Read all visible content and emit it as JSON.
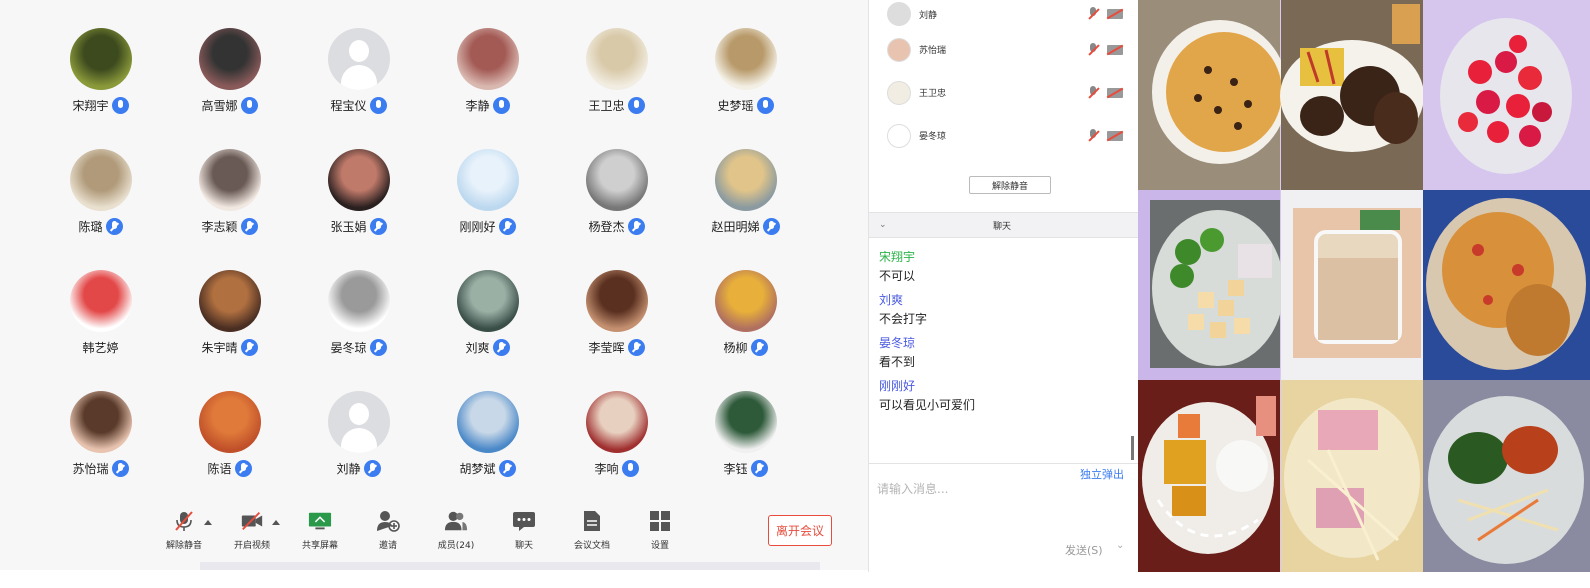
{
  "participants": [
    {
      "name": "宋翔宇",
      "mic": "on",
      "avatar_color": "#8a9a3a",
      "avatar_color2": "#3d4a1e"
    },
    {
      "name": "高雪娜",
      "mic": "on",
      "avatar_color": "#8a5a5a",
      "avatar_color2": "#333333",
      "host": true
    },
    {
      "name": "程宝仪",
      "mic": "on",
      "avatar_color": "blank"
    },
    {
      "name": "李静",
      "mic": "on",
      "avatar_color": "#d9b8b0",
      "avatar_color2": "#a35a55"
    },
    {
      "name": "王卫忠",
      "mic": "on",
      "avatar_color": "#f2ede2",
      "avatar_color2": "#d8c9a8"
    },
    {
      "name": "史梦瑶",
      "mic": "on",
      "avatar_color": "#f3efe4",
      "avatar_color2": "#b89a6a"
    },
    {
      "name": "陈璐",
      "mic": "muted",
      "avatar_color": "#e9e0cf",
      "avatar_color2": "#b09a7a"
    },
    {
      "name": "李志颖",
      "mic": "muted",
      "avatar_color": "#f2e8e2",
      "avatar_color2": "#6a5a55"
    },
    {
      "name": "张玉娟",
      "mic": "muted",
      "avatar_color": "#2a2020",
      "avatar_color2": "#c07a6a"
    },
    {
      "name": "刚刚好",
      "mic": "muted",
      "avatar_color": "#bcd8ef",
      "avatar_color2": "#e8f2fb"
    },
    {
      "name": "杨登杰",
      "mic": "muted",
      "avatar_color": "#777777",
      "avatar_color2": "#cfcfcf"
    },
    {
      "name": "赵田明娣",
      "mic": "muted",
      "avatar_color": "#8a9aa0",
      "avatar_color2": "#e0c48a"
    },
    {
      "name": "韩艺婷",
      "mic": "none",
      "avatar_color": "#ffffff",
      "avatar_color2": "#e34848"
    },
    {
      "name": "朱宇晴",
      "mic": "muted",
      "avatar_color": "#4a2e22",
      "avatar_color2": "#b07040"
    },
    {
      "name": "晏冬琼",
      "mic": "muted",
      "avatar_color": "#ffffff",
      "avatar_color2": "#9a9a9a"
    },
    {
      "name": "刘爽",
      "mic": "muted",
      "avatar_color": "#3a4e48",
      "avatar_color2": "#9ab0a5"
    },
    {
      "name": "李莹晖",
      "mic": "muted",
      "avatar_color": "#c49070",
      "avatar_color2": "#5a3020"
    },
    {
      "name": "杨柳",
      "mic": "muted",
      "avatar_color": "#b07060",
      "avatar_color2": "#e8b03a"
    },
    {
      "name": "苏怡瑞",
      "mic": "muted",
      "avatar_color": "#e8c4b0",
      "avatar_color2": "#5a3a2a"
    },
    {
      "name": "陈语",
      "mic": "muted",
      "avatar_color": "#c0502a",
      "avatar_color2": "#e07a3a"
    },
    {
      "name": "刘静",
      "mic": "muted",
      "avatar_color": "blank"
    },
    {
      "name": "胡梦斌",
      "mic": "muted",
      "avatar_color": "#4a88c8",
      "avatar_color2": "#c8d8e8"
    },
    {
      "name": "李响",
      "mic": "on",
      "avatar_color": "#a03030",
      "avatar_color2": "#e8d0c0"
    },
    {
      "name": "李钰",
      "mic": "muted",
      "avatar_color": "#f0f0f0",
      "avatar_color2": "#2e5a3a"
    }
  ],
  "toolbar": {
    "unmute": "解除静音",
    "video": "开启视频",
    "share": "共享屏幕",
    "invite": "邀请",
    "members": "成员(24)",
    "chat": "聊天",
    "docs": "会议文档",
    "settings": "设置",
    "leave": "离开会议"
  },
  "member_list": [
    {
      "name": "刘静",
      "avatar_color": "#dddddd"
    },
    {
      "name": "苏怡瑞",
      "avatar_color": "#e8c4b0"
    },
    {
      "name": "王卫忠",
      "avatar_color": "#f2ede2"
    },
    {
      "name": "晏冬琼",
      "avatar_color": "#ffffff"
    }
  ],
  "unmute_all": "解除静音",
  "chat": {
    "title": "聊天",
    "collapse_icon": "chevron-down-icon",
    "messages": [
      {
        "sender": "宋翔宇",
        "color": "#2db34a",
        "text": "不可以"
      },
      {
        "sender": "刘爽",
        "color": "#4a5ae0",
        "text": "不会打字"
      },
      {
        "sender": "晏冬琼",
        "color": "#4a5ae0",
        "text": "看不到"
      },
      {
        "sender": "刚刚好",
        "color": "#4a5ae0",
        "text": "可以看见小可爱们"
      }
    ],
    "popout": "独立弹出",
    "input_placeholder": "请输入消息...",
    "send": "发送(S)"
  },
  "colors": {
    "accent": "#3b7cf0",
    "danger": "#e74c3c",
    "share_green": "#2a9a4a"
  }
}
